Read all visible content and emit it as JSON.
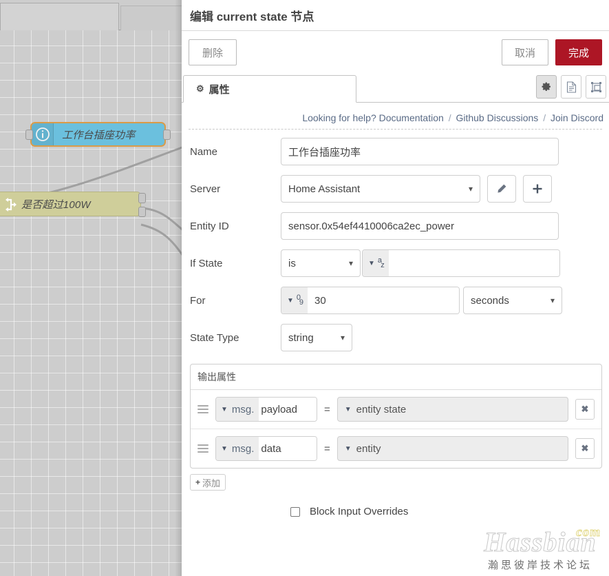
{
  "canvas": {
    "nodes": [
      {
        "label": "工作台插座功率",
        "icon": "info-icon",
        "color": "#6bc0de",
        "selected": true
      },
      {
        "label": "是否超过100W",
        "icon": "switch-icon",
        "color": "#cfce9a",
        "selected": false
      }
    ]
  },
  "panel": {
    "title": "编辑 current state 节点",
    "toolbar": {
      "delete_label": "删除",
      "cancel_label": "取消",
      "done_label": "完成",
      "done_color": "#ad1625"
    },
    "tabs": {
      "properties_label": "属性",
      "icons": [
        {
          "name": "gear-icon",
          "glyph": "⚙",
          "active": true
        },
        {
          "name": "description-icon",
          "glyph": "📄",
          "active": false
        },
        {
          "name": "appearance-icon",
          "glyph": "▣",
          "active": false
        }
      ]
    },
    "help": {
      "prefix": "Looking for help?",
      "links": [
        "Documentation",
        "Github Discussions",
        "Join Discord"
      ],
      "separator": "/"
    },
    "form": {
      "name": {
        "label": "Name",
        "value": "工作台插座功率"
      },
      "server": {
        "label": "Server",
        "value": "Home Assistant",
        "edit_icon": "pencil-icon",
        "add_icon": "plus-icon"
      },
      "entity_id": {
        "label": "Entity ID",
        "value": "sensor.0x54ef4410006ca2ec_power"
      },
      "if_state": {
        "label": "If State",
        "operator": "is",
        "type_glyph_top": "a",
        "type_glyph_bottom": "z",
        "value": ""
      },
      "for": {
        "label": "For",
        "type_glyph_top": "0",
        "type_glyph_bottom": "9",
        "value": "30",
        "unit": "seconds"
      },
      "state_type": {
        "label": "State Type",
        "value": "string"
      }
    },
    "output_properties": {
      "legend": "输出属性",
      "rows": [
        {
          "prop_prefix": "msg.",
          "prop_name": "payload",
          "eq": "=",
          "value": "entity state"
        },
        {
          "prop_prefix": "msg.",
          "prop_name": "data",
          "eq": "=",
          "value": "entity"
        }
      ],
      "add_label": "添加",
      "add_plus": "+",
      "remove_glyph": "✖"
    },
    "block_input_overrides": {
      "label": "Block Input Overrides",
      "checked": false
    }
  },
  "watermark": {
    "main": "Hassbian",
    "tld": "com",
    "sub": "瀚思彼岸技术论坛"
  }
}
